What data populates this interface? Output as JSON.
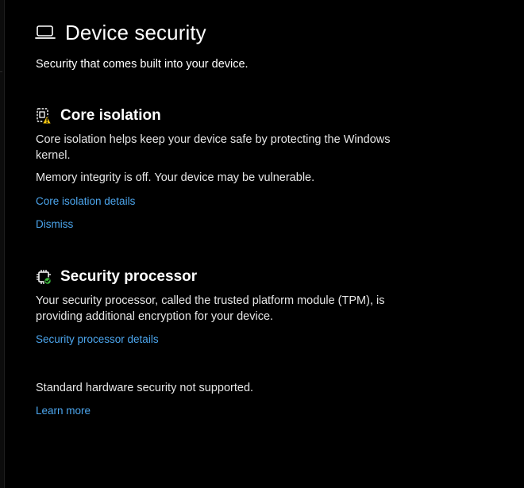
{
  "page": {
    "title": "Device security",
    "subtitle": "Security that comes built into your device.",
    "title_icon": "laptop-icon"
  },
  "core_isolation": {
    "title": "Core isolation",
    "icon": "core-isolation-warning-icon",
    "description": "Core isolation helps keep your device safe by protecting the Windows kernel.",
    "status": "Memory integrity is off. Your device may be vulnerable.",
    "details_link": "Core isolation details",
    "dismiss_link": "Dismiss"
  },
  "security_processor": {
    "title": "Security processor",
    "icon": "chip-check-icon",
    "description": "Your security processor, called the trusted platform module (TPM), is providing additional encryption for your device.",
    "details_link": "Security processor details"
  },
  "hardware_security": {
    "status": "Standard hardware security not supported.",
    "learn_more_link": "Learn more"
  },
  "colors": {
    "background": "#000000",
    "link": "#4CA6EE",
    "warning": "#F2C511",
    "success": "#3FBF3F"
  }
}
